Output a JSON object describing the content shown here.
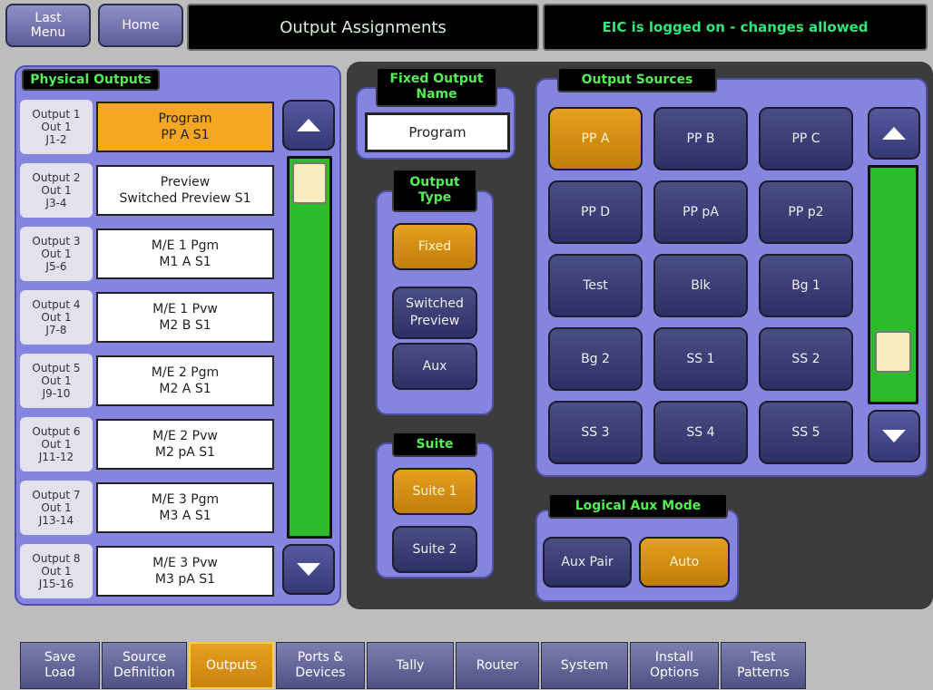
{
  "header": {
    "last_menu": "Last\nMenu",
    "home": "Home",
    "title": "Output Assignments",
    "status": "EIC is logged on - changes allowed"
  },
  "physical_outputs": {
    "title": "Physical Outputs",
    "rows": [
      {
        "label": [
          "Output 1",
          "Out 1",
          "J1-2"
        ],
        "line1": "Program",
        "line2": "PP A S1",
        "selected": true
      },
      {
        "label": [
          "Output 2",
          "Out 1",
          "J3-4"
        ],
        "line1": "Preview",
        "line2": "Switched Preview S1",
        "selected": false
      },
      {
        "label": [
          "Output 3",
          "Out 1",
          "J5-6"
        ],
        "line1": "M/E 1 Pgm",
        "line2": "M1 A S1",
        "selected": false
      },
      {
        "label": [
          "Output 4",
          "Out 1",
          "J7-8"
        ],
        "line1": "M/E 1 Pvw",
        "line2": "M2 B S1",
        "selected": false
      },
      {
        "label": [
          "Output 5",
          "Out 1",
          "J9-10"
        ],
        "line1": "M/E 2 Pgm",
        "line2": "M2 A S1",
        "selected": false
      },
      {
        "label": [
          "Output 6",
          "Out 1",
          "J11-12"
        ],
        "line1": "M/E 2 Pvw",
        "line2": "M2 pA S1",
        "selected": false
      },
      {
        "label": [
          "Output 7",
          "Out 1",
          "J13-14"
        ],
        "line1": "M/E 3 Pgm",
        "line2": "M3 A S1",
        "selected": false
      },
      {
        "label": [
          "Output 8",
          "Out 1",
          "J15-16"
        ],
        "line1": "M/E 3 Pvw",
        "line2": "M3 pA S1",
        "selected": false
      }
    ]
  },
  "fixed_output_name": {
    "title": "Fixed Output\nName",
    "value": "Program"
  },
  "output_type": {
    "title": "Output\nType",
    "buttons": [
      {
        "label": "Fixed",
        "active": true
      },
      {
        "label": "Switched\nPreview",
        "active": false
      },
      {
        "label": "Aux",
        "active": false
      }
    ]
  },
  "suite": {
    "title": "Suite",
    "buttons": [
      {
        "label": "Suite 1",
        "active": true
      },
      {
        "label": "Suite 2",
        "active": false
      }
    ]
  },
  "output_sources": {
    "title": "Output Sources",
    "buttons": [
      {
        "label": "PP A",
        "active": true
      },
      {
        "label": "PP B",
        "active": false
      },
      {
        "label": "PP C",
        "active": false
      },
      {
        "label": "PP D",
        "active": false
      },
      {
        "label": "PP pA",
        "active": false
      },
      {
        "label": "PP p2",
        "active": false
      },
      {
        "label": "Test",
        "active": false
      },
      {
        "label": "Blk",
        "active": false
      },
      {
        "label": "Bg 1",
        "active": false
      },
      {
        "label": "Bg 2",
        "active": false
      },
      {
        "label": "SS 1",
        "active": false
      },
      {
        "label": "SS 2",
        "active": false
      },
      {
        "label": "SS 3",
        "active": false
      },
      {
        "label": "SS 4",
        "active": false
      },
      {
        "label": "SS 5",
        "active": false
      }
    ]
  },
  "logical_aux_mode": {
    "title": "Logical Aux Mode",
    "buttons": [
      {
        "label": "Aux Pair",
        "active": false
      },
      {
        "label": "Auto",
        "active": true
      }
    ]
  },
  "bottom_tabs": [
    {
      "label": "Save\nLoad",
      "active": false
    },
    {
      "label": "Source\nDefinition",
      "active": false
    },
    {
      "label": "Outputs",
      "active": true
    },
    {
      "label": "Ports &\nDevices",
      "active": false
    },
    {
      "label": "Tally",
      "active": false
    },
    {
      "label": "Router",
      "active": false
    },
    {
      "label": "System",
      "active": false
    },
    {
      "label": "Install\nOptions",
      "active": false
    },
    {
      "label": "Test\nPatterns",
      "active": false
    }
  ],
  "colors": {
    "accent_gold": "#f5a623",
    "panel_blue": "#8585e0",
    "scroll_green": "#2bbb2b",
    "status_green": "#2ee87a"
  }
}
